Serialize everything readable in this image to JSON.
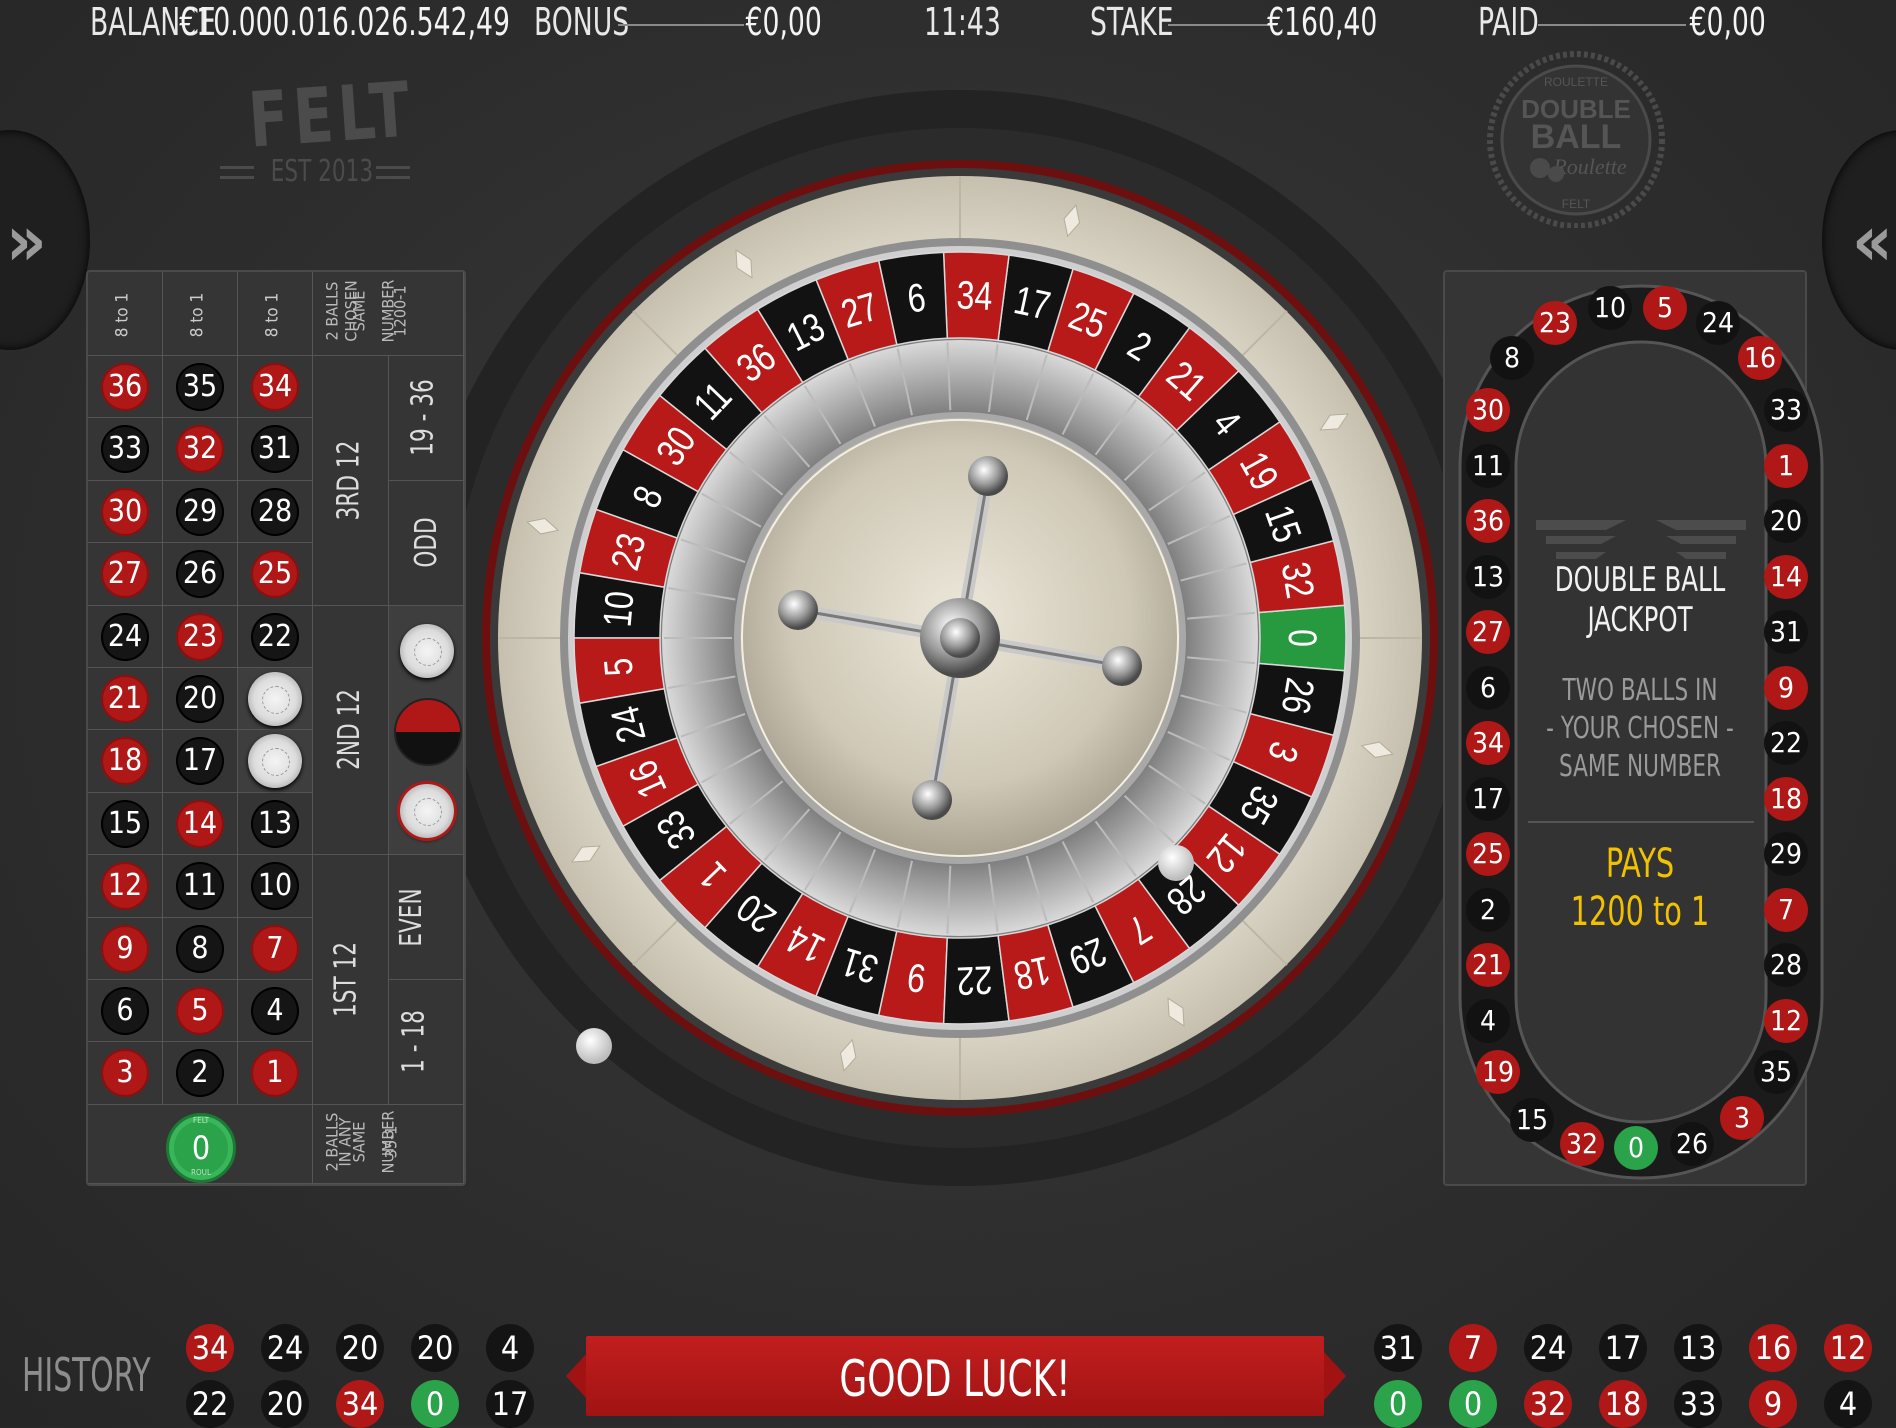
{
  "header": {
    "balance_label": "BALANCE",
    "balance_value": "€10.000.016.026.542,49",
    "bonus_label": "BONUS",
    "bonus_value": "€0,00",
    "time": "11:43",
    "stake_label": "STAKE",
    "stake_value": "€160,40",
    "paid_label": "PAID",
    "paid_value": "€0,00"
  },
  "logos": {
    "felt": "FELT",
    "felt_est": "EST 2013",
    "double_ball_top": "ROULETTE",
    "double_ball_main1": "DOUBLE",
    "double_ball_main2": "BALL",
    "double_ball_script": "Roulette",
    "double_ball_bottom": "FELT"
  },
  "nav": {
    "left_arrow": "»",
    "right_arrow": "«"
  },
  "bet_table": {
    "column_bets": [
      "8 to 1",
      "8 to 1",
      "8 to 1"
    ],
    "two_balls_chosen": [
      "2 BALLS",
      "CHOSEN",
      "SAME",
      "NUMBER",
      "1200-1"
    ],
    "two_balls_any": [
      "2 BALLS",
      "IN ANY",
      "SAME",
      "NUMBER",
      "35-1"
    ],
    "dozens": [
      "3RD 12",
      "2ND 12",
      "1ST 12"
    ],
    "dozen_sup": [
      "RD",
      "ND",
      "ST"
    ],
    "dozen_main": [
      "3",
      "2",
      "1"
    ],
    "outside": [
      "19 - 36",
      "ODD",
      "EVEN",
      "1 - 18"
    ],
    "rows": [
      [
        {
          "n": "36",
          "c": "red"
        },
        {
          "n": "35",
          "c": "black"
        },
        {
          "n": "34",
          "c": "red"
        }
      ],
      [
        {
          "n": "33",
          "c": "black"
        },
        {
          "n": "32",
          "c": "red"
        },
        {
          "n": "31",
          "c": "black"
        }
      ],
      [
        {
          "n": "30",
          "c": "red"
        },
        {
          "n": "29",
          "c": "black"
        },
        {
          "n": "28",
          "c": "black"
        }
      ],
      [
        {
          "n": "27",
          "c": "red"
        },
        {
          "n": "26",
          "c": "black"
        },
        {
          "n": "25",
          "c": "red"
        }
      ],
      [
        {
          "n": "24",
          "c": "black"
        },
        {
          "n": "23",
          "c": "red"
        },
        {
          "n": "22",
          "c": "black"
        }
      ],
      [
        {
          "n": "21",
          "c": "red"
        },
        {
          "n": "20",
          "c": "black"
        },
        {
          "n": "",
          "c": "chip"
        }
      ],
      [
        {
          "n": "18",
          "c": "red"
        },
        {
          "n": "17",
          "c": "black"
        },
        {
          "n": "",
          "c": "chip"
        }
      ],
      [
        {
          "n": "15",
          "c": "black"
        },
        {
          "n": "14",
          "c": "red"
        },
        {
          "n": "13",
          "c": "black"
        }
      ],
      [
        {
          "n": "12",
          "c": "red"
        },
        {
          "n": "11",
          "c": "black"
        },
        {
          "n": "10",
          "c": "black"
        }
      ],
      [
        {
          "n": "9",
          "c": "red"
        },
        {
          "n": "8",
          "c": "black"
        },
        {
          "n": "7",
          "c": "red"
        }
      ],
      [
        {
          "n": "6",
          "c": "black"
        },
        {
          "n": "5",
          "c": "red"
        },
        {
          "n": "4",
          "c": "black"
        }
      ],
      [
        {
          "n": "3",
          "c": "red"
        },
        {
          "n": "2",
          "c": "black"
        },
        {
          "n": "1",
          "c": "red"
        }
      ]
    ],
    "zero": "0",
    "zero_ring_top": "FELT",
    "zero_ring_bottom": "ROUL"
  },
  "wheel": {
    "sequence": [
      "0",
      "32",
      "15",
      "19",
      "4",
      "21",
      "2",
      "25",
      "17",
      "34",
      "6",
      "27",
      "13",
      "36",
      "11",
      "30",
      "8",
      "23",
      "10",
      "5",
      "24",
      "16",
      "33",
      "1",
      "20",
      "14",
      "31",
      "9",
      "22",
      "18",
      "29",
      "7",
      "28",
      "12",
      "35",
      "3",
      "26"
    ],
    "colors": {
      "red": "#b81a1a",
      "black": "#121212",
      "green": "#279a3f",
      "cream": "#d6d0c2"
    }
  },
  "racetrack": {
    "top": [
      {
        "n": "23",
        "c": "red"
      },
      {
        "n": "10",
        "c": "black"
      },
      {
        "n": "5",
        "c": "red"
      },
      {
        "n": "24",
        "c": "black"
      }
    ],
    "left_diag": [
      {
        "n": "8",
        "c": "black"
      }
    ],
    "right_diag": [
      {
        "n": "16",
        "c": "red"
      }
    ],
    "left": [
      {
        "n": "30",
        "c": "red"
      },
      {
        "n": "11",
        "c": "black"
      },
      {
        "n": "36",
        "c": "red"
      },
      {
        "n": "13",
        "c": "black"
      },
      {
        "n": "27",
        "c": "red"
      },
      {
        "n": "6",
        "c": "black"
      },
      {
        "n": "34",
        "c": "red"
      },
      {
        "n": "17",
        "c": "black"
      },
      {
        "n": "25",
        "c": "red"
      },
      {
        "n": "2",
        "c": "black"
      },
      {
        "n": "21",
        "c": "red"
      },
      {
        "n": "4",
        "c": "black"
      }
    ],
    "right": [
      {
        "n": "33",
        "c": "black"
      },
      {
        "n": "1",
        "c": "red"
      },
      {
        "n": "20",
        "c": "black"
      },
      {
        "n": "14",
        "c": "red"
      },
      {
        "n": "31",
        "c": "black"
      },
      {
        "n": "9",
        "c": "red"
      },
      {
        "n": "22",
        "c": "black"
      },
      {
        "n": "18",
        "c": "red"
      },
      {
        "n": "29",
        "c": "black"
      },
      {
        "n": "7",
        "c": "red"
      },
      {
        "n": "28",
        "c": "black"
      },
      {
        "n": "12",
        "c": "red"
      }
    ],
    "bottom_left": [
      {
        "n": "19",
        "c": "red"
      },
      {
        "n": "15",
        "c": "black"
      }
    ],
    "bottom": [
      {
        "n": "32",
        "c": "red"
      },
      {
        "n": "0",
        "c": "green"
      },
      {
        "n": "26",
        "c": "black"
      }
    ],
    "bottom_right": [
      {
        "n": "35",
        "c": "black"
      },
      {
        "n": "3",
        "c": "red"
      }
    ]
  },
  "jackpot": {
    "title1": "DOUBLE BALL",
    "title2": "JACKPOT",
    "desc1": "TWO BALLS IN",
    "desc2": "- YOUR CHOSEN -",
    "desc3": "SAME NUMBER",
    "pays_label": "PAYS",
    "pays_value": "1200 to 1",
    "accent": "#f2c200"
  },
  "history": {
    "label": "HISTORY",
    "left_top": [
      {
        "n": "34",
        "c": "red"
      },
      {
        "n": "24",
        "c": "black"
      },
      {
        "n": "20",
        "c": "black"
      },
      {
        "n": "20",
        "c": "black"
      },
      {
        "n": "4",
        "c": "black"
      }
    ],
    "left_bottom": [
      {
        "n": "22",
        "c": "black"
      },
      {
        "n": "20",
        "c": "black"
      },
      {
        "n": "34",
        "c": "red"
      },
      {
        "n": "0",
        "c": "green"
      },
      {
        "n": "17",
        "c": "black"
      }
    ],
    "right_top": [
      {
        "n": "31",
        "c": "black"
      },
      {
        "n": "7",
        "c": "red"
      },
      {
        "n": "24",
        "c": "black"
      },
      {
        "n": "17",
        "c": "black"
      },
      {
        "n": "13",
        "c": "black"
      },
      {
        "n": "16",
        "c": "red"
      },
      {
        "n": "12",
        "c": "red"
      }
    ],
    "right_bottom": [
      {
        "n": "0",
        "c": "green"
      },
      {
        "n": "0",
        "c": "green"
      },
      {
        "n": "32",
        "c": "red"
      },
      {
        "n": "18",
        "c": "red"
      },
      {
        "n": "33",
        "c": "black"
      },
      {
        "n": "9",
        "c": "red"
      },
      {
        "n": "4",
        "c": "black"
      }
    ]
  },
  "status": {
    "message": "GOOD LUCK!"
  }
}
